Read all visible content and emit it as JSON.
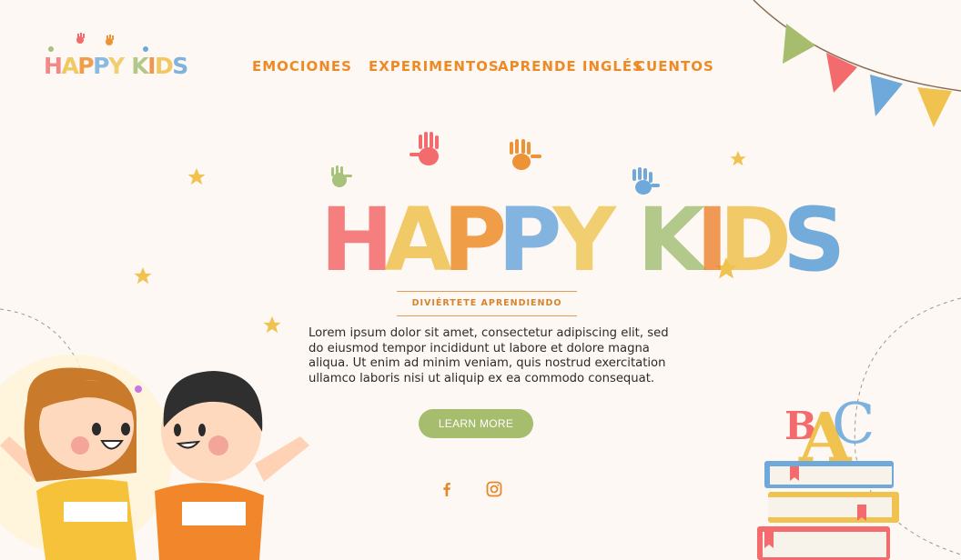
{
  "brand": {
    "logo_letters": [
      {
        "ch": "H",
        "color": "#f2797a"
      },
      {
        "ch": "A",
        "color": "#f0c24f"
      },
      {
        "ch": "P",
        "color": "#ee9236"
      },
      {
        "ch": "P",
        "color": "#78b2e0"
      },
      {
        "ch": "Y",
        "color": "#f0c95c"
      },
      {
        "ch": " ",
        "color": "#000000"
      },
      {
        "ch": "K",
        "color": "#a7c27a"
      },
      {
        "ch": "I",
        "color": "#ee8a3a"
      },
      {
        "ch": "D",
        "color": "#f0c24f"
      },
      {
        "ch": "S",
        "color": "#6fa9dc"
      }
    ]
  },
  "nav": {
    "items": [
      {
        "label": "EMOCIONES"
      },
      {
        "label": "EXPERIMENTOS"
      },
      {
        "label": "APRENDE INGLÉS"
      },
      {
        "label": "CUENTOS"
      }
    ]
  },
  "hero": {
    "title_letters": [
      {
        "ch": "H",
        "color": "#f46b6d"
      },
      {
        "ch": "A",
        "color": "#f0c24f"
      },
      {
        "ch": "P",
        "color": "#ee8f2c"
      },
      {
        "ch": "P",
        "color": "#6fa9dc"
      },
      {
        "ch": "Y",
        "color": "#f0c95c"
      },
      {
        "ch": " ",
        "color": "#000000"
      },
      {
        "ch": "K",
        "color": "#a7c27a"
      },
      {
        "ch": "I",
        "color": "#ee8a3a"
      },
      {
        "ch": "D",
        "color": "#f0c24f"
      },
      {
        "ch": "S",
        "color": "#5d9fd8"
      }
    ],
    "tagline": "DIVIÉRTETE APRENDIENDO",
    "description": "Lorem ipsum dolor sit amet, consectetur adipiscing elit, sed do eiusmod tempor incididunt ut labore et dolore magna aliqua. Ut enim ad minim veniam, quis nostrud exercitation ullamco laboris nisi ut aliquip ex ea commodo consequat.",
    "cta_label": "LEARN MORE"
  },
  "social": {
    "facebook_icon": "facebook-icon",
    "instagram_icon": "instagram-icon",
    "color": "#e8872a"
  },
  "decor": {
    "abc_letters": [
      "B",
      "A",
      "C"
    ],
    "colors": {
      "accent": "#ee8a25",
      "green": "#a5bd6d",
      "pink": "#f46b6d",
      "blue": "#6fa9dc",
      "yellow": "#f0c24f",
      "background": "#fdf8f3"
    }
  }
}
